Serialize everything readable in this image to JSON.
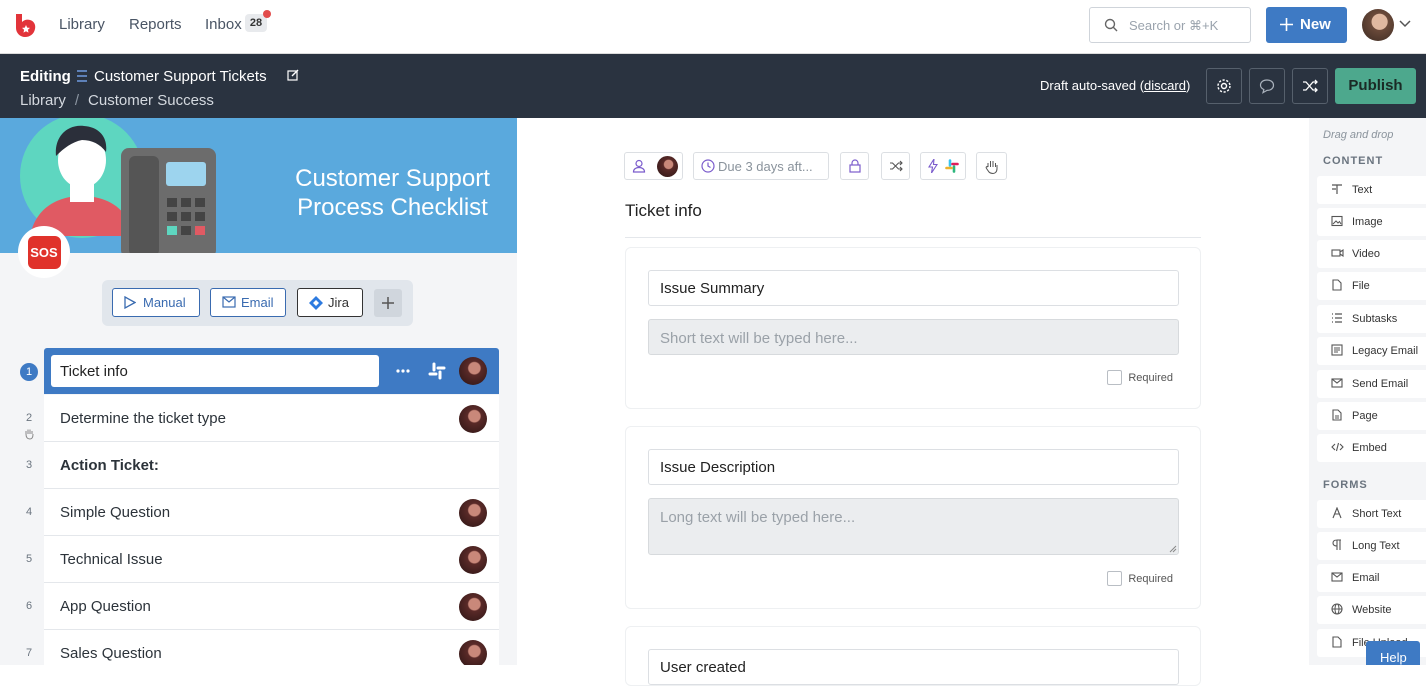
{
  "nav": {
    "library": "Library",
    "reports": "Reports",
    "inbox": "Inbox",
    "inbox_count": "28",
    "search_placeholder": "Search or ⌘+K",
    "new_label": "New"
  },
  "editbar": {
    "editing": "Editing",
    "title": "Customer Support Tickets",
    "breadcrumb": [
      "Library",
      "Customer Success"
    ],
    "autosave_text": "Draft auto-saved (",
    "discard": "discard",
    "autosave_end": ")",
    "publish": "Publish"
  },
  "banner": {
    "line1": "Customer Support",
    "line2": "Process Checklist",
    "sos": "SOS"
  },
  "triggers": [
    "Manual",
    "Email",
    "Jira"
  ],
  "tasks": [
    {
      "num": "1",
      "label": "Ticket info"
    },
    {
      "num": "2",
      "label": "Determine the ticket type"
    },
    {
      "num": "3",
      "label": "Action Ticket:"
    },
    {
      "num": "4",
      "label": "Simple Question"
    },
    {
      "num": "5",
      "label": "Technical Issue"
    },
    {
      "num": "6",
      "label": "App Question"
    },
    {
      "num": "7",
      "label": "Sales Question"
    }
  ],
  "toolbar": {
    "due": "Due 3 days aft..."
  },
  "section": {
    "title": "Ticket info",
    "fields": [
      {
        "label": "Issue Summary",
        "placeholder": "Short text will be typed here...",
        "required": "Required"
      },
      {
        "label": "Issue Description",
        "placeholder": "Long text will be typed here...",
        "required": "Required"
      },
      {
        "label": "User created"
      }
    ]
  },
  "sidebar": {
    "hint": "Drag and drop",
    "content_head": "CONTENT",
    "content": [
      "Text",
      "Image",
      "Video",
      "File",
      "Subtasks",
      "Legacy Email",
      "Send Email",
      "Page",
      "Embed"
    ],
    "forms_head": "FORMS",
    "forms": [
      "Short Text",
      "Long Text",
      "Email",
      "Website",
      "File Upload"
    ]
  },
  "help": "Help",
  "colors": {
    "primary": "#3e7ac4",
    "publish": "#4da88d",
    "editbar": "#2a3340",
    "banner": "#5aa9dd"
  }
}
